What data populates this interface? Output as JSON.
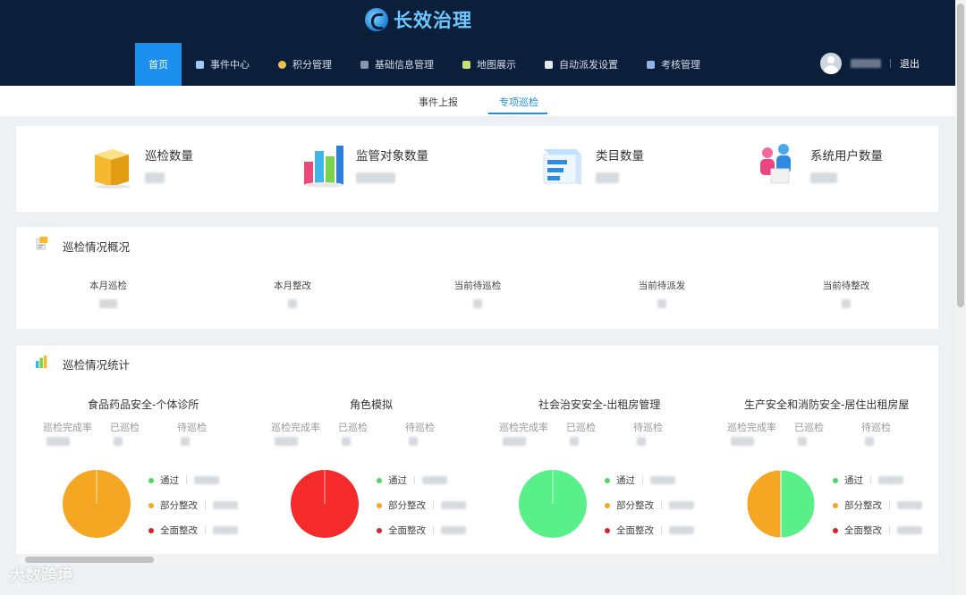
{
  "header": {
    "logo_text": "长效治理",
    "nav": [
      {
        "label": "首页",
        "active": true
      },
      {
        "label": "事件中心",
        "icon": "document-icon"
      },
      {
        "label": "积分管理",
        "icon": "coin-icon"
      },
      {
        "label": "基础信息管理",
        "icon": "database-icon"
      },
      {
        "label": "地图展示",
        "icon": "map-icon"
      },
      {
        "label": "自动派发设置",
        "icon": "clipboard-icon"
      },
      {
        "label": "考核管理",
        "icon": "monitor-icon"
      }
    ],
    "logout": "退出"
  },
  "subtabs": [
    {
      "label": "事件上报",
      "active": false
    },
    {
      "label": "专项巡检",
      "active": true
    }
  ],
  "stats": [
    {
      "label": "巡检数量",
      "icon": "folder-icon"
    },
    {
      "label": "监管对象数量",
      "icon": "bar-chart-icon"
    },
    {
      "label": "类目数量",
      "icon": "category-icon"
    },
    {
      "label": "系统用户数量",
      "icon": "users-icon"
    }
  ],
  "overview": {
    "title": "巡检情况概况",
    "items": [
      "本月巡检",
      "本月整改",
      "当前待巡检",
      "当前待派发",
      "当前待整改"
    ]
  },
  "statistics": {
    "title": "巡检情况统计",
    "col_labels": [
      "巡检完成率",
      "已巡检",
      "待巡检"
    ],
    "legend": [
      {
        "label": "通过",
        "color": "#4cd964"
      },
      {
        "label": "部分整改",
        "color": "#f5a623"
      },
      {
        "label": "全面整改",
        "color": "#e02020"
      }
    ],
    "charts": [
      {
        "title": "食品药品安全-个体诊所",
        "slices": [
          {
            "color": "#f5a623",
            "value": 100
          }
        ]
      },
      {
        "title": "角色模拟",
        "slices": [
          {
            "color": "#f52a2a",
            "value": 100
          }
        ]
      },
      {
        "title": "社会治安安全-出租房管理",
        "slices": [
          {
            "color": "#59f08a",
            "value": 100
          }
        ]
      },
      {
        "title": "生产安全和消防安全-居住出租房屋",
        "slices": [
          {
            "color": "#59f08a",
            "value": 50
          },
          {
            "color": "#f5a623",
            "value": 50
          }
        ]
      }
    ]
  },
  "colors": {
    "header_bg": "#0b1f3a",
    "accent": "#1a8fee"
  },
  "watermark": "大数跨境"
}
